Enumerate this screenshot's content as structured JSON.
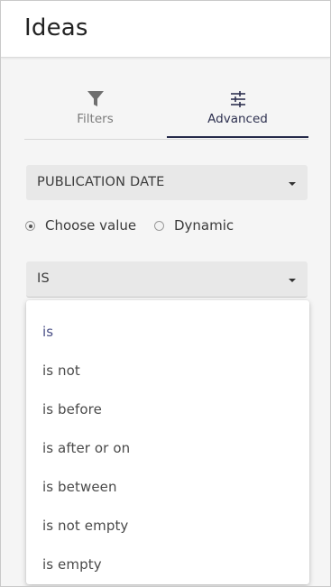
{
  "header": {
    "title": "Ideas"
  },
  "tabs": [
    {
      "label": "Filters",
      "icon": "filter-icon",
      "active": false
    },
    {
      "label": "Advanced",
      "icon": "sliders-icon",
      "active": true
    }
  ],
  "field_select": {
    "value": "PUBLICATION DATE"
  },
  "mode": {
    "options": [
      "Choose value",
      "Dynamic"
    ],
    "selected": "Choose value"
  },
  "operator_select": {
    "value": "IS"
  },
  "operator_dropdown": {
    "selected": "is",
    "options": [
      "is",
      "is not",
      "is before",
      "is after or on",
      "is between",
      "is not empty",
      "is empty"
    ]
  },
  "colors": {
    "accent": "#262a4a",
    "selected_option": "#4a4f86",
    "select_background": "#e8e8e8",
    "panel_background": "#f5f5f5"
  }
}
